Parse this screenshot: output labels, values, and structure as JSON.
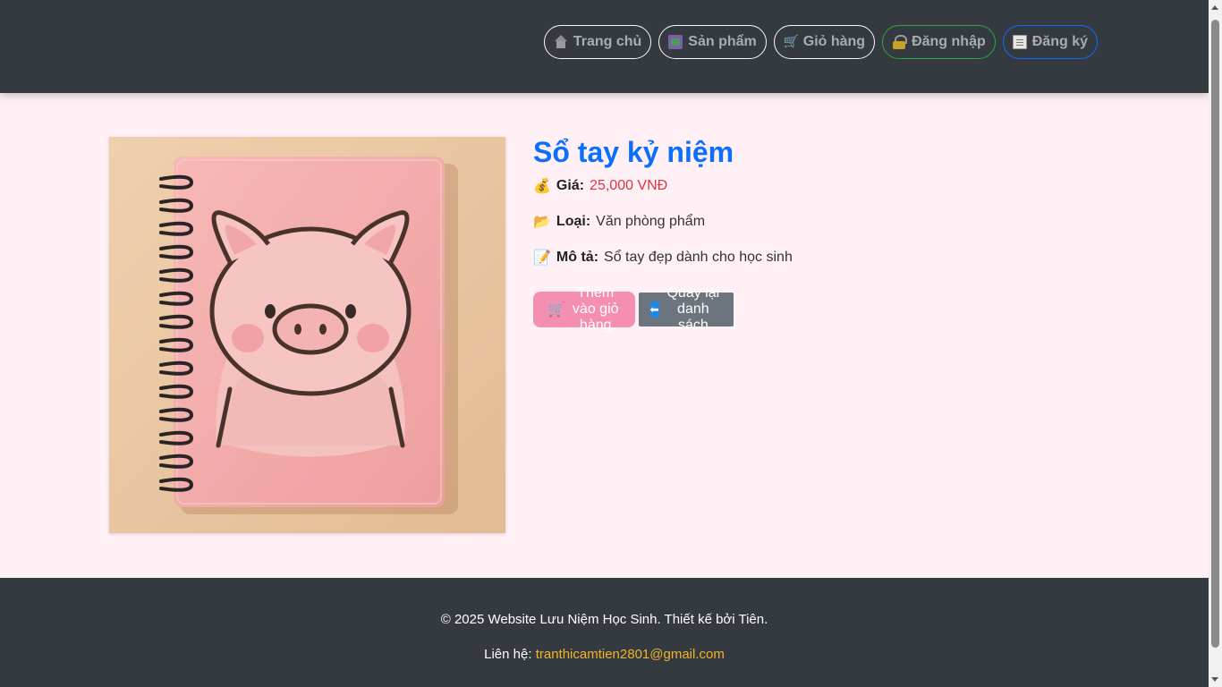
{
  "nav": {
    "home": {
      "label": "Trang chủ",
      "icon": "home-icon"
    },
    "products": {
      "label": "Sản phẩm",
      "icon": "shopping-bag-icon"
    },
    "cart": {
      "label": "Giỏ hàng",
      "icon": "cart-icon"
    },
    "login": {
      "label": "Đăng nhập",
      "icon": "lock-icon"
    },
    "register": {
      "label": "Đăng ký",
      "icon": "memo-icon"
    }
  },
  "product": {
    "name": "Sổ tay kỷ niệm",
    "price_label": "Giá:",
    "price_value": "25,000 VNĐ",
    "category_label": "Loại:",
    "category_value": "Văn phòng phẩm",
    "description_label": "Mô tả:",
    "description_value": "Sổ tay đẹp dành cho học sinh",
    "icons": {
      "price": "💰",
      "category": "📂",
      "description": "📝"
    }
  },
  "actions": {
    "add_to_cart": "Thêm vào giỏ hàng",
    "back_to_list": "Quay lại danh sách"
  },
  "footer": {
    "copyright": "© 2025 Website Lưu Niệm Học Sinh. Thiết kế bởi Tiên.",
    "contact_label": "Liên hệ:",
    "contact_email": "tranthicamtien2801@gmail.com"
  },
  "colors": {
    "header_bg": "#343a40",
    "page_bg": "#fff0f5",
    "title": "#0d6efd",
    "price": "#dc3545",
    "cart_button": "#f48fb1",
    "back_button": "#6c757d",
    "email_link": "#f0b429"
  }
}
